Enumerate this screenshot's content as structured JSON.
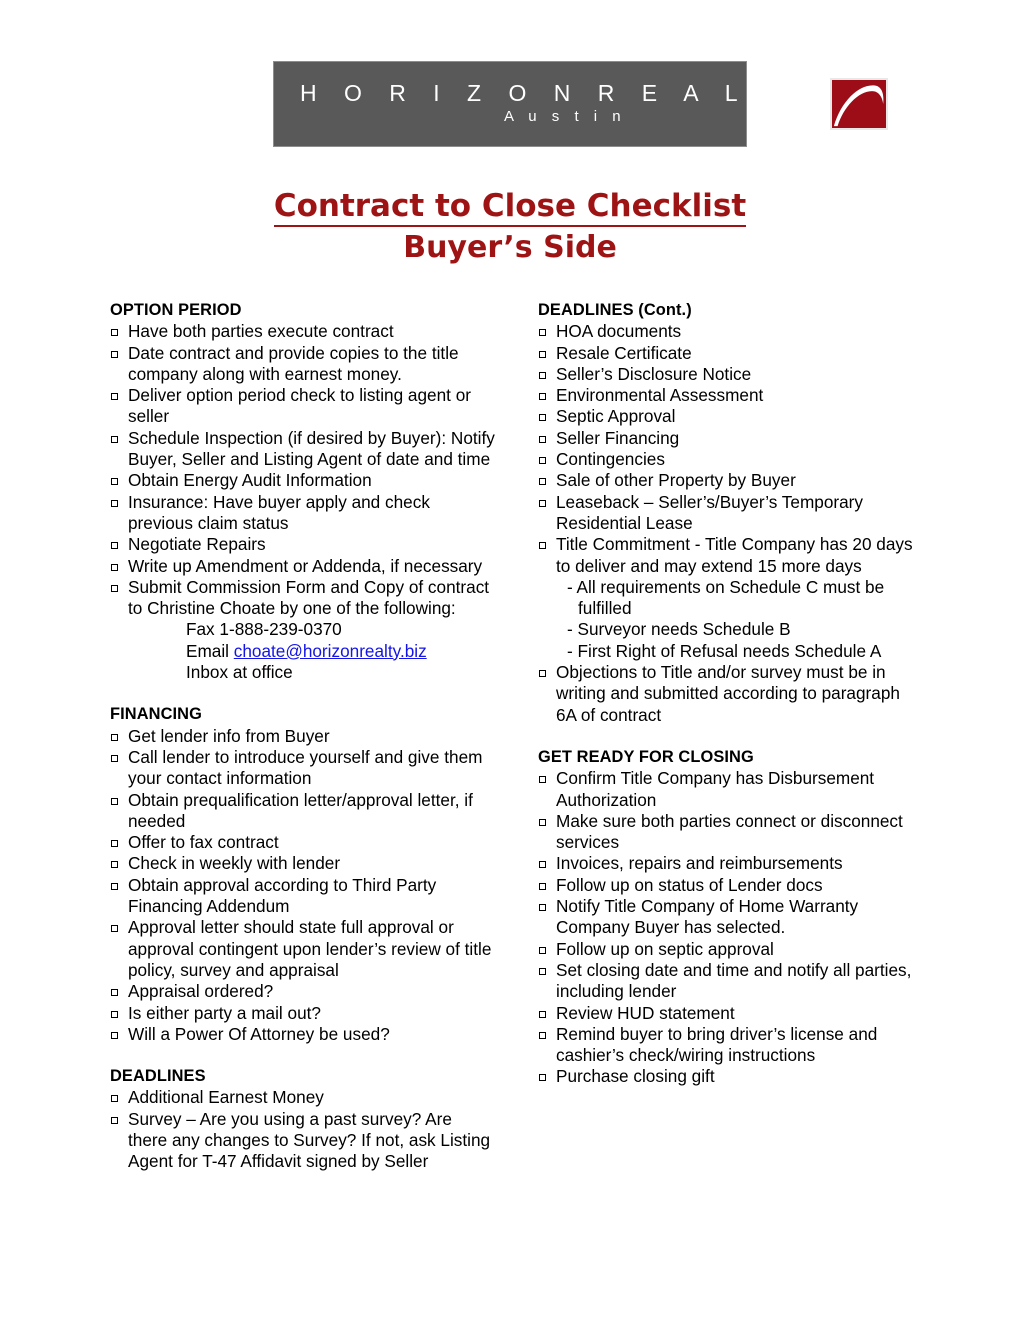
{
  "brand": {
    "company": "H O R I Z O N   R E A L T Y",
    "city": "A u s t i n",
    "mark_color": "#9c0d18",
    "banner_color": "#595959"
  },
  "title": {
    "main": "Contract to Close Checklist",
    "sub": "Buyer’s Side",
    "color": "#9e1414"
  },
  "left_column": [
    {
      "heading": "OPTION PERIOD",
      "items": [
        "Have both parties execute contract",
        "Date contract and provide copies to the title company along with earnest money.",
        "Deliver option period check to listing agent or seller",
        "Schedule Inspection (if desired by Buyer): Notify Buyer, Seller and Listing Agent of date and time",
        "Obtain Energy Audit Information",
        "Insurance:  Have buyer apply and check previous claim status",
        "Negotiate Repairs",
        "Write up Amendment or Addenda, if necessary",
        "Submit Commission Form and Copy of contract to Christine Choate by one of the following:"
      ],
      "sub_lines": [
        "Fax 1-888-239-0370",
        "Email ",
        "Inbox at office"
      ],
      "email": "choate@horizonrealty.biz"
    },
    {
      "heading": "FINANCING",
      "items": [
        "Get lender info from Buyer",
        "Call lender to introduce yourself and give them your contact information",
        "Obtain prequalification letter/approval letter, if needed",
        "Offer to fax contract",
        "Check in weekly with lender",
        "Obtain approval according to Third Party Financing Addendum",
        "Approval letter should state full approval or approval contingent upon lender’s review of title policy, survey  and appraisal",
        "Appraisal ordered?",
        "Is either party a mail out?",
        "Will a Power Of Attorney be used?"
      ]
    },
    {
      "heading": "DEADLINES",
      "items": [
        "Additional Earnest Money",
        "Survey – Are you using a past survey? Are there any changes to Survey? If not, ask Listing Agent for T-47 Affidavit signed by Seller"
      ]
    }
  ],
  "right_column": [
    {
      "heading": "DEADLINES (Cont.)",
      "items": [
        "HOA documents",
        "Resale Certificate",
        "Seller’s Disclosure Notice",
        "Environmental Assessment",
        "Septic Approval",
        "Seller Financing",
        "Contingencies",
        "Sale of other Property by Buyer",
        "Leaseback – Seller’s/Buyer’s Temporary Residential Lease",
        "Title Commitment - Title Company has 20 days to deliver and may extend 15 more days"
      ],
      "dash_lines": [
        "- All requirements on Schedule C must be fulfilled",
        "- Surveyor needs Schedule B",
        "- First Right of Refusal needs Schedule A"
      ],
      "trailing_items": [
        "Objections to Title and/or survey must be in writing and submitted according to paragraph 6A of contract"
      ]
    },
    {
      "heading": "GET READY FOR CLOSING",
      "items": [
        "Confirm Title Company has Disbursement Authorization",
        "Make sure both parties connect or disconnect services",
        "Invoices, repairs and reimbursements",
        "Follow up on status of Lender docs",
        "Notify Title Company of Home Warranty Company Buyer has selected.",
        "Follow up on septic approval",
        "Set closing date and time and notify all parties, including lender",
        "Review HUD statement",
        "Remind buyer to bring driver’s license and cashier’s check/wiring instructions",
        "Purchase closing gift"
      ]
    }
  ]
}
